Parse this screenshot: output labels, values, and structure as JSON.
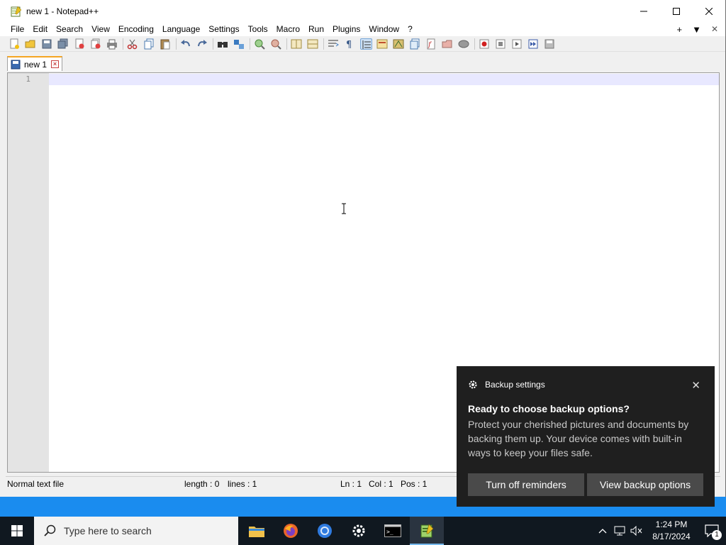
{
  "window": {
    "title": "new 1 - Notepad++",
    "controls": {
      "minimize": "—",
      "maximize": "☐",
      "close": "✕"
    }
  },
  "menu": {
    "items": [
      "File",
      "Edit",
      "Search",
      "View",
      "Encoding",
      "Language",
      "Settings",
      "Tools",
      "Macro",
      "Run",
      "Plugins",
      "Window",
      "?"
    ],
    "right": {
      "plus": "+",
      "dropdown": "▼",
      "close": "✕"
    }
  },
  "toolbar": {
    "icons": [
      "new-file-icon",
      "open-file-icon",
      "save-icon",
      "save-all-icon",
      "close-icon",
      "close-all-icon",
      "print-icon",
      "cut-icon",
      "copy-icon",
      "paste-icon",
      "undo-icon",
      "redo-icon",
      "find-icon",
      "replace-icon",
      "zoom-in-icon",
      "zoom-out-icon",
      "sync-vertical-icon",
      "sync-horizontal-icon",
      "word-wrap-icon",
      "show-all-chars-icon",
      "indent-guide-icon",
      "udl-icon",
      "doc-map-icon",
      "doc-list-icon",
      "function-list-icon",
      "folder-workspace-icon",
      "monitoring-icon",
      "record-macro-icon",
      "stop-macro-icon",
      "play-macro-icon",
      "run-macro-multiple-icon",
      "save-macro-icon"
    ]
  },
  "tab": {
    "label": "new 1"
  },
  "editor": {
    "line_numbers": [
      "1"
    ],
    "content": ""
  },
  "status": {
    "file_type": "Normal text file",
    "length": "length : 0",
    "lines": "lines : 1",
    "ln": "Ln : 1",
    "col": "Col : 1",
    "pos": "Pos : 1"
  },
  "toast": {
    "app_name": "Backup settings",
    "title": "Ready to choose backup options?",
    "body": "Protect your cherished pictures and documents by backing them up. Your device comes with built-in ways to keep your files safe.",
    "buttons": [
      "Turn off reminders",
      "View backup options"
    ],
    "close": "✕"
  },
  "taskbar": {
    "search_placeholder": "Type here to search",
    "apps": [
      "file-explorer-icon",
      "firefox-icon",
      "chrome-icon",
      "settings-icon",
      "terminal-icon",
      "notepadpp-icon"
    ],
    "time": "1:24 PM",
    "date": "8/17/2024",
    "notification_count": "1"
  },
  "colors": {
    "toast_bg": "#1f1f1f",
    "toast_button": "#4a4a4a",
    "taskbar_bg": "#101820",
    "desktop": "#0d7de0",
    "current_line": "#e8e8ff"
  }
}
